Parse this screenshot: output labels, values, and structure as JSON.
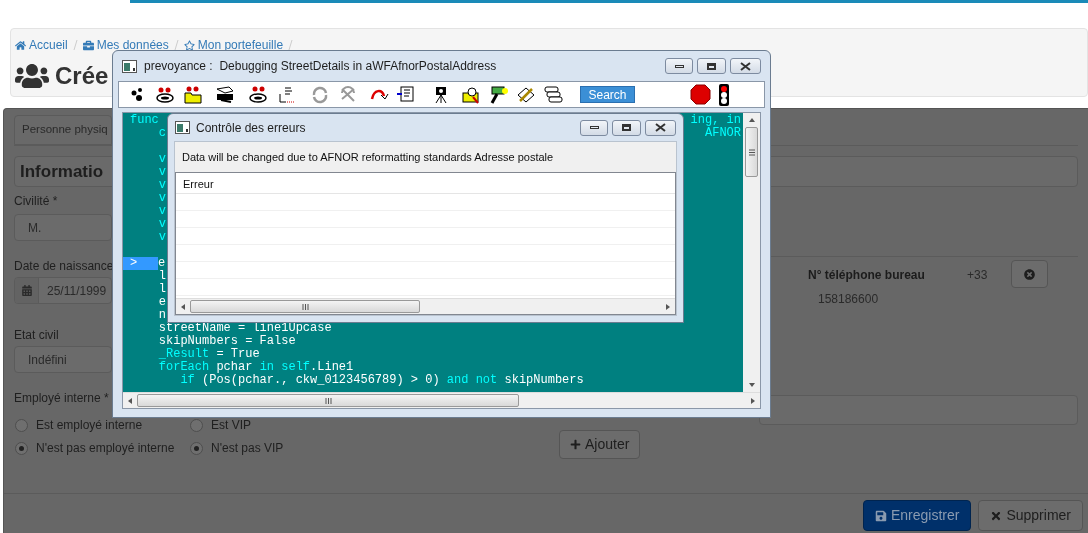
{
  "breadcrumb": [
    {
      "label": "Accueil"
    },
    {
      "label": "Mes données"
    },
    {
      "label": "Mon portefeuille"
    }
  ],
  "page_title": "Crée",
  "tab": {
    "label": "Personne physiq"
  },
  "section_title": "Informatio",
  "fields": [
    {
      "label": "Civilité *",
      "value": "M.",
      "kind": "select"
    },
    {
      "label": "Date de naissance",
      "value": "25/11/1999",
      "kind": "date"
    },
    {
      "label": "Etat civil",
      "value": "Indéfini",
      "kind": "select"
    }
  ],
  "employee": {
    "label": "Employé interne *",
    "options": [
      {
        "label": "Est employé interne",
        "selected": false
      },
      {
        "label": "N'est pas employé interne",
        "selected": true
      }
    ]
  },
  "vip": {
    "options": [
      {
        "label": "Est VIP",
        "selected": false
      },
      {
        "label": "N'est pas VIP",
        "selected": true
      }
    ]
  },
  "phone": {
    "label": "N° téléphone bureau",
    "prefix": "+33",
    "number": "158186600"
  },
  "add_button": "Ajouter",
  "actions": [
    {
      "label": "Enregistrer",
      "kind": "primary"
    },
    {
      "label": "Supprimer",
      "kind": "default"
    }
  ],
  "debugger": {
    "title": "prevoyance :  Debugging StreetDetails in aWFAfnorPostalAddress",
    "search_button": "Search",
    "code_lines": [
      {
        "tokens": [
          {
            "text": "func",
            "kind": "keyword"
          }
        ],
        "right": "ing, in"
      },
      {
        "tokens": [
          {
            "text": "    c",
            "kind": "keyword"
          }
        ],
        "right": "AFNOR"
      },
      {
        "kind": "blank"
      },
      {
        "tokens": [
          {
            "text": "    v",
            "kind": "keyword"
          }
        ]
      },
      {
        "tokens": [
          {
            "text": "    v",
            "kind": "keyword"
          }
        ]
      },
      {
        "tokens": [
          {
            "text": "    v",
            "kind": "keyword"
          }
        ]
      },
      {
        "tokens": [
          {
            "text": "    v",
            "kind": "keyword"
          }
        ]
      },
      {
        "tokens": [
          {
            "text": "    v",
            "kind": "keyword"
          }
        ]
      },
      {
        "tokens": [
          {
            "text": "    v",
            "kind": "keyword"
          }
        ]
      },
      {
        "tokens": [
          {
            "text": "    v",
            "kind": "keyword"
          }
        ]
      },
      {
        "kind": "blank"
      },
      {
        "marker": ">",
        "tokens": [
          {
            "text": "e",
            "kind": "plain"
          }
        ]
      },
      {
        "tokens": [
          {
            "text": "    l",
            "kind": "plain"
          }
        ]
      },
      {
        "tokens": [
          {
            "text": "    l",
            "kind": "plain"
          }
        ]
      },
      {
        "tokens": [
          {
            "text": "    e",
            "kind": "plain"
          }
        ]
      },
      {
        "tokens": [
          {
            "text": "    n",
            "kind": "plain"
          }
        ]
      },
      {
        "tokens": [
          {
            "text": "    streetName = line1Upcase",
            "kind": "plain"
          }
        ]
      },
      {
        "tokens": [
          {
            "text": "    skipNumbers = False",
            "kind": "plain"
          }
        ]
      },
      {
        "tokens": [
          {
            "text": "    _Result",
            "kind": "keyword"
          },
          {
            "text": " = True",
            "kind": "plain"
          }
        ]
      },
      {
        "tokens": [
          {
            "text": "    forEach",
            "kind": "keyword"
          },
          {
            "text": " pchar ",
            "kind": "plain"
          },
          {
            "text": "in self",
            "kind": "keyword"
          },
          {
            "text": ".Line1",
            "kind": "plain"
          }
        ]
      },
      {
        "tokens": [
          {
            "text": "       if",
            "kind": "keyword"
          },
          {
            "text": " (Pos(pchar., ckw_0123456789) > 0) ",
            "kind": "plain"
          },
          {
            "text": "and not",
            "kind": "keyword"
          },
          {
            "text": " skipNumbers",
            "kind": "plain"
          }
        ]
      }
    ]
  },
  "error_dialog": {
    "title": "Contrôle des erreurs",
    "message": "Data will be changed due to AFNOR reformatting standards Adresse postale",
    "columns": [
      "Erreur"
    ]
  }
}
